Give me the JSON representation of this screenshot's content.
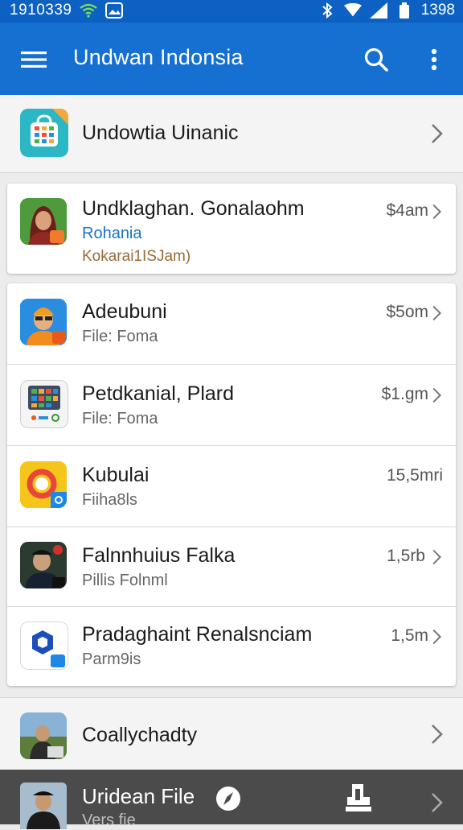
{
  "status_bar": {
    "time": "1910339",
    "clock": "1398"
  },
  "app_bar": {
    "title": "Undwan Indonsia"
  },
  "top_item": {
    "title": "Undowtia Uinanic"
  },
  "featured": {
    "title": "Undklaghan. Gonalaohm",
    "subtitle": "Rohania",
    "detail": "Kokarai1ISJam)",
    "price": "$4am"
  },
  "list": [
    {
      "title": "Adeubuni",
      "subtitle": "File: Foma",
      "meta": "$5om"
    },
    {
      "title": "Petdkanial, Plard",
      "subtitle": "File: Foma",
      "meta": "$1.gm"
    },
    {
      "title": "Kubulai",
      "subtitle": "Fiiha8ls",
      "meta": "15,5mri"
    },
    {
      "title": "Falnnhuius Falka",
      "subtitle": "Pillis Folnml",
      "meta": "1,5rb"
    },
    {
      "title": "Pradaghaint Renalsnciam",
      "subtitle": "Parm9is",
      "meta": "1,5m"
    }
  ],
  "lower_item": {
    "title": "Coallychadty"
  },
  "bottom_bar": {
    "title": "Uridean File",
    "subtitle": "Vers fie"
  },
  "colors": {
    "app_bar": "#1570d2",
    "status_bar": "#0d61c2",
    "bottom_bar": "#4b4b4b",
    "link": "#1a73c8",
    "detail": "#9a6a3a"
  }
}
